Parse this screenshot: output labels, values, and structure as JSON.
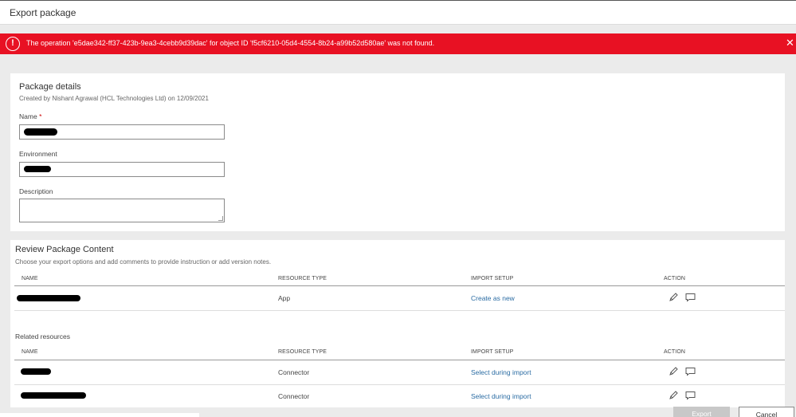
{
  "window": {
    "title": "Export package"
  },
  "error": {
    "icon": "error-circle-icon",
    "message": "The operation 'e5dae342-ff37-423b-9ea3-4cebb9d39dac' for object ID 'f5cf6210-05d4-4554-8b24-a99b52d580ae' was not found.",
    "close_icon": "close-icon",
    "color": "#e81123"
  },
  "package_details": {
    "title": "Package details",
    "created_by": "Created by Nishant Agrawal (HCL Technologies Ltd) on 12/09/2021",
    "name_label": "Name",
    "required_mark": "*",
    "environment_label": "Environment",
    "description_label": "Description"
  },
  "review": {
    "title": "Review Package Content",
    "subtitle": "Choose your export options and add comments to provide instruction or add version notes.",
    "columns": [
      "NAME",
      "RESOURCE TYPE",
      "IMPORT SETUP",
      "ACTION"
    ],
    "rows": [
      {
        "resource_type": "App",
        "import_setup": "Create as new"
      }
    ]
  },
  "related": {
    "title": "Related resources",
    "columns": [
      "NAME",
      "RESOURCE TYPE",
      "IMPORT SETUP",
      "ACTION"
    ],
    "rows": [
      {
        "resource_type": "Connector",
        "import_setup": "Select during import"
      },
      {
        "resource_type": "Connector",
        "import_setup": "Select during import"
      }
    ]
  },
  "footer": {
    "export_label": "Export",
    "cancel_label": "Cancel"
  },
  "colors": {
    "accent": "#2b6ca3",
    "error": "#e81123",
    "disabled": "#c8c8c8"
  }
}
